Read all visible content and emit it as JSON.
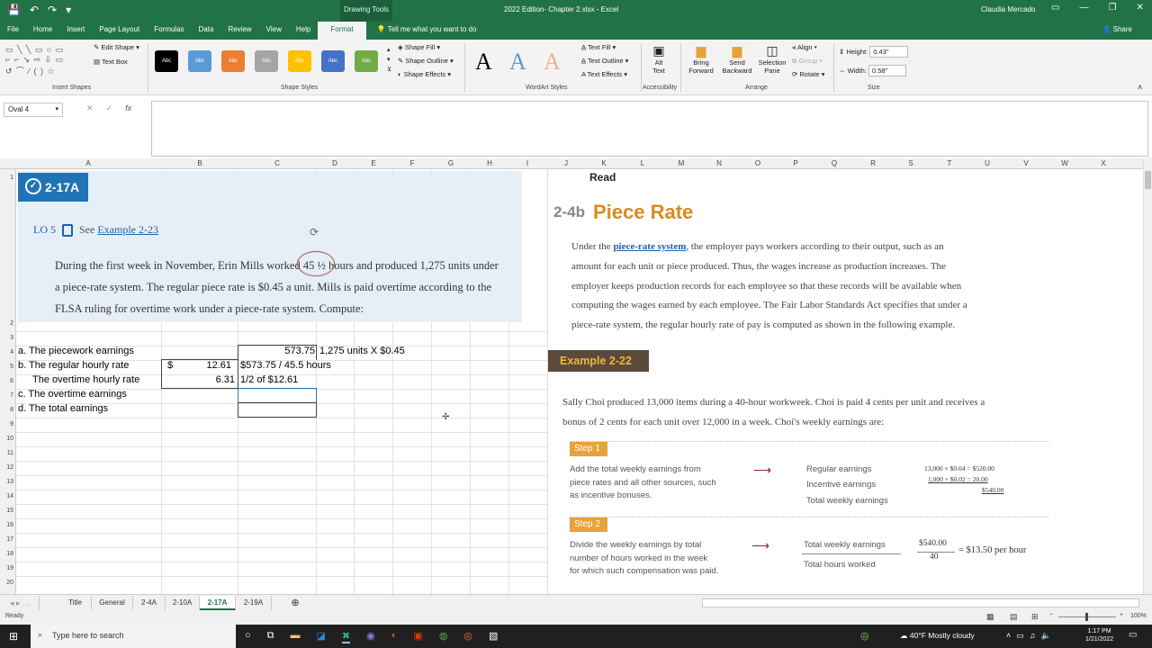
{
  "titlebar": {
    "context": "Drawing Tools",
    "doc_title": "2022 Edition- Chapter 2.xlsx  -  Excel",
    "user": "Claudia Mercado"
  },
  "ribbon_tabs": [
    "File",
    "Home",
    "Insert",
    "Page Layout",
    "Formulas",
    "Data",
    "Review",
    "View",
    "Help",
    "Format"
  ],
  "tell_me": "Tell me what you want to do",
  "share": "Share",
  "ribbon": {
    "insert_shapes": "Insert Shapes",
    "edit_shape": "Edit Shape",
    "text_box": "Text Box",
    "shape_styles": "Shape Styles",
    "shape_fill": "Shape Fill",
    "shape_outline": "Shape Outline",
    "shape_effects": "Shape Effects",
    "swatch_label": "Abc",
    "wordart": "WordArt Styles",
    "text_fill": "Text Fill",
    "text_outline": "Text Outline",
    "text_effects": "Text Effects",
    "accessibility": "Accessibility",
    "alt_text": "Alt Text",
    "arrange": "Arrange",
    "bring_forward": "Bring Forward",
    "send_backward": "Send Backward",
    "selection_pane": "Selection Pane",
    "align": "Align",
    "group": "Group",
    "rotate": "Rotate",
    "size": "Size",
    "height_label": "Height:",
    "height_val": "0.43\"",
    "width_label": "Width:",
    "width_val": "0.58\""
  },
  "namebox": "Oval 4",
  "columns": [
    "A",
    "B",
    "C",
    "D",
    "E",
    "F",
    "G",
    "H",
    "I",
    "J",
    "K",
    "L",
    "M",
    "N",
    "O",
    "P",
    "Q",
    "R",
    "S",
    "T",
    "U",
    "V",
    "W",
    "X"
  ],
  "rows": [
    "1",
    "2",
    "3",
    "4",
    "5",
    "6",
    "7",
    "8",
    "9",
    "10",
    "11",
    "12",
    "13",
    "14",
    "15",
    "16",
    "17",
    "18",
    "19",
    "20"
  ],
  "problem": {
    "badge": "2-17A",
    "lo": "LO 5",
    "see": "See",
    "example_link": "Example 2-23",
    "line1": "During the first week in November, Erin Mills worked 45 ½ hours and produced 1,275 units under",
    "line2": "a piece-rate system. The regular piece rate is $0.45 a unit. Mills is paid overtime according to the",
    "line3": "FLSA ruling for overtime work under a piece-rate system. Compute:"
  },
  "cells": {
    "a4": "a. The piecework earnings",
    "c4": "573.75",
    "d4": "1,275 units X $0.45",
    "a5": "b. The regular hourly rate",
    "b5_cur": "$",
    "b5": "12.61",
    "c5": "$573.75 / 45.5 hours",
    "a6": "The overtime hourly rate",
    "b6": "6.31",
    "c6": "1/2 of $12.61",
    "a7": "c. The overtime earnings",
    "a8": "d. The total earnings"
  },
  "reading": {
    "read": "Read",
    "section_num": "2-4b",
    "section_title": "Piece Rate",
    "p1a": "Under the ",
    "p1_term": "piece-rate system",
    "p1b": ", the employer pays workers according to their output, such as an",
    "p2": "amount for each unit or piece produced. Thus, the wages increase as production increases. The",
    "p3": "employer keeps production records for each employee so that these records will be available when",
    "p4": "computing the wages earned by each employee. The Fair Labor Standards Act specifies that under a",
    "p5": "piece-rate system, the regular hourly rate of pay is computed as shown in the following example.",
    "example": "Example 2-22",
    "ex1": "Sally Choi produced 13,000 items during a 40-hour workweek. Choi is paid 4 cents per unit and receives a",
    "ex2": "bonus of 2 cents for each unit over 12,000 in a week. Choi's weekly earnings are:",
    "step1": "Step 1",
    "s1a": "Add the total weekly earnings from",
    "s1b": "piece rates and all other sources, such",
    "s1c": "as incentive bonuses.",
    "reg": "Regular earnings",
    "inc": "Incentive earnings",
    "tot": "Total weekly earnings",
    "calc1": "13,000 × $0.04 = $520.00",
    "calc2": "1,000 × $0.02 =    20.00",
    "calc3": "$540.00",
    "step2": "Step 2",
    "s2a": "Divide the weekly earnings by total",
    "s2b": "number of hours worked in the week",
    "s2c": "for which such compensation was paid.",
    "tw": "Total weekly earnings",
    "th": "Total hours worked",
    "num": "$540.00",
    "den": "40",
    "res": "= $13.50 per hour"
  },
  "sheets": [
    "Title",
    "General",
    "2-4A",
    "2-10A",
    "2-17A",
    "2-19A"
  ],
  "status": "Ready",
  "zoom": "100%",
  "taskbar": {
    "search": "Type here to search",
    "weather": "40°F  Mostly cloudy",
    "time": "1:17 PM",
    "date": "1/21/2022"
  },
  "colors": {
    "excel_green": "#217346",
    "badge_blue": "#1f73b7",
    "orange": "#e8a23a",
    "example_bg": "#5a4a3a"
  }
}
